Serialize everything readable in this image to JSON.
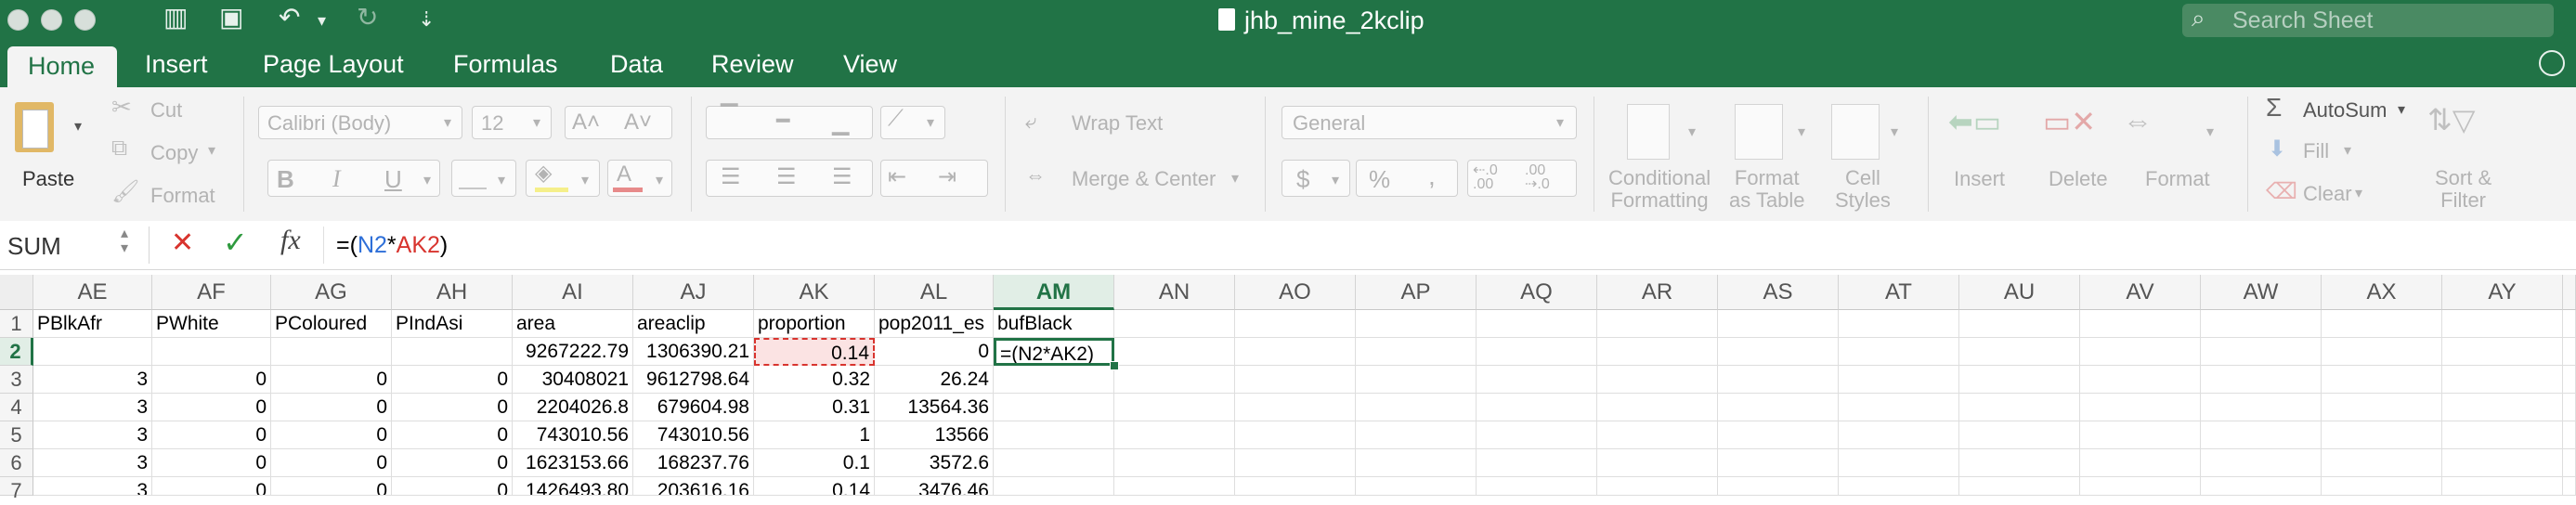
{
  "window": {
    "title": "jhb_mine_2kclip",
    "search_placeholder": "Search Sheet"
  },
  "tabs": [
    "Home",
    "Insert",
    "Page Layout",
    "Formulas",
    "Data",
    "Review",
    "View"
  ],
  "active_tab": "Home",
  "ribbon": {
    "paste": "Paste",
    "cut": "Cut",
    "copy": "Copy",
    "format": "Format",
    "font_name": "Calibri (Body)",
    "font_size": "12",
    "bold": "B",
    "italic": "I",
    "underline": "U",
    "wrap_text": "Wrap Text",
    "merge_center": "Merge & Center",
    "number_format": "General",
    "currency": "$",
    "percent": "%",
    "comma": ",",
    "cond_format_1": "Conditional",
    "cond_format_2": "Formatting",
    "format_table_1": "Format",
    "format_table_2": "as Table",
    "cell_styles_1": "Cell",
    "cell_styles_2": "Styles",
    "insert": "Insert",
    "delete": "Delete",
    "format_cells": "Format",
    "autosum": "AutoSum",
    "fill": "Fill",
    "clear": "Clear",
    "sort_filter_1": "Sort &",
    "sort_filter_2": "Filter"
  },
  "formula_bar": {
    "name_box": "SUM",
    "formula_prefix": "=(",
    "ref1": "N2",
    "op": "*",
    "ref2": "AK2",
    "formula_suffix": ")"
  },
  "columns": [
    "AE",
    "AF",
    "AG",
    "AH",
    "AI",
    "AJ",
    "AK",
    "AL",
    "AM",
    "AN",
    "AO",
    "AP",
    "AQ",
    "AR",
    "AS",
    "AT",
    "AU",
    "AV",
    "AW",
    "AX",
    "AY"
  ],
  "active_column": "AM",
  "rows": [
    {
      "n": "1",
      "cells": [
        "PBlkAfr",
        "PWhite",
        "PColoured",
        "PIndAsi",
        "area",
        "areaclip",
        "proportion",
        "pop2011_es",
        "bufBlack"
      ]
    },
    {
      "n": "2",
      "cells": [
        "",
        "",
        "",
        "",
        "9267222.79",
        "1306390.21",
        "0.14",
        "0",
        "=(N2*AK2)"
      ]
    },
    {
      "n": "3",
      "cells": [
        "3",
        "0",
        "0",
        "0",
        "30408021",
        "9612798.64",
        "0.32",
        "26.24",
        ""
      ]
    },
    {
      "n": "4",
      "cells": [
        "3",
        "0",
        "0",
        "0",
        "2204026.8",
        "679604.98",
        "0.31",
        "13564.36",
        ""
      ]
    },
    {
      "n": "5",
      "cells": [
        "3",
        "0",
        "0",
        "0",
        "743010.56",
        "743010.56",
        "1",
        "13566",
        ""
      ]
    },
    {
      "n": "6",
      "cells": [
        "3",
        "0",
        "0",
        "0",
        "1623153.66",
        "168237.76",
        "0.1",
        "3572.6",
        ""
      ]
    },
    {
      "n": "7",
      "cells": [
        "3",
        "0",
        "0",
        "0",
        "1426493.80",
        "203616.16",
        "0.14",
        "3476.46",
        ""
      ]
    }
  ],
  "active_row": "2",
  "colors": {
    "brand": "#217346",
    "ref_blue": "#2e6fd8",
    "ref_red": "#d8342e",
    "active_cell_border": "#217346"
  }
}
